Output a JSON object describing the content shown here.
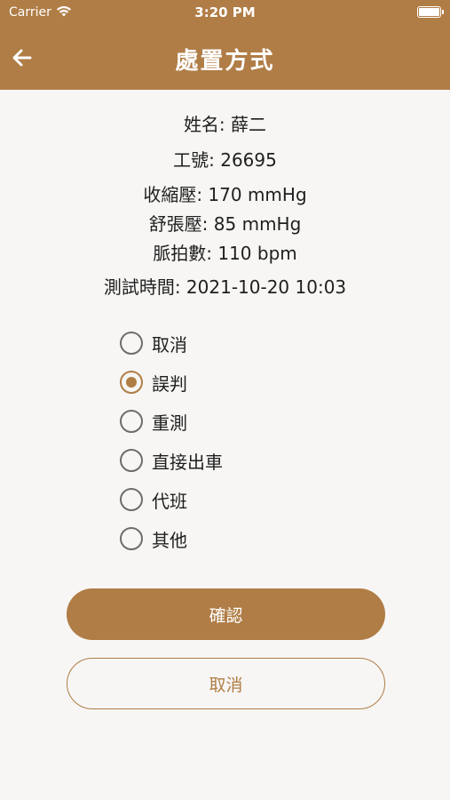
{
  "status_bar": {
    "carrier": "Carrier",
    "time": "3:20 PM",
    "wifi_icon": "wifi-icon",
    "battery_icon": "battery-icon"
  },
  "nav": {
    "title": "處置方式",
    "back_icon": "arrow-left-icon"
  },
  "info": {
    "name": "姓名: 薛二",
    "employee_id": "工號: 26695",
    "systolic": "收縮壓: 170 mmHg",
    "diastolic": "舒張壓: 85 mmHg",
    "pulse": "脈拍數: 110 bpm",
    "test_time": "測試時間: 2021-10-20 10:03"
  },
  "options": [
    {
      "label": "取消",
      "selected": false
    },
    {
      "label": "誤判",
      "selected": true
    },
    {
      "label": "重測",
      "selected": false
    },
    {
      "label": "直接出車",
      "selected": false
    },
    {
      "label": "代班",
      "selected": false
    },
    {
      "label": "其他",
      "selected": false
    }
  ],
  "buttons": {
    "confirm": "確認",
    "cancel": "取消"
  },
  "colors": {
    "accent": "#b07d46",
    "background": "#f7f6f4"
  }
}
